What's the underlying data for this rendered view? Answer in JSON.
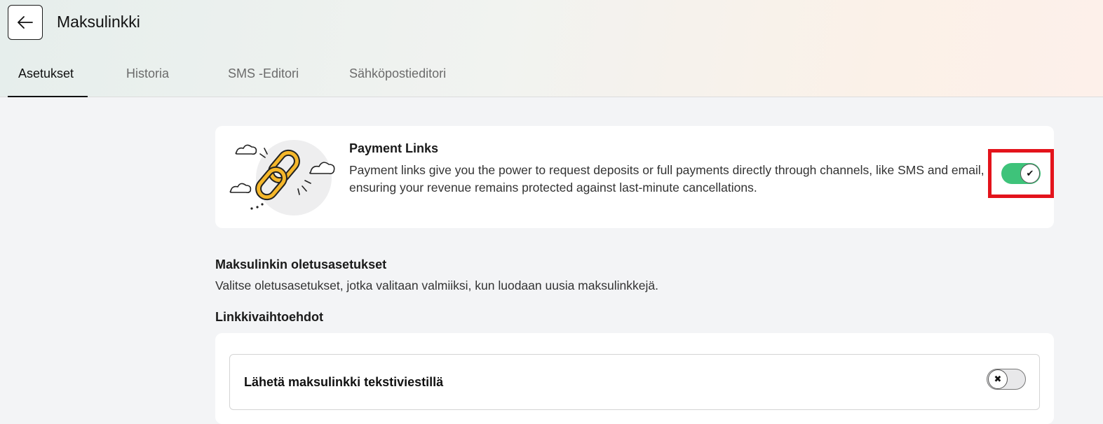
{
  "header": {
    "title": "Maksulinkki",
    "back_icon": "arrow-left-icon"
  },
  "tabs": [
    {
      "label": "Asetukset",
      "active": true
    },
    {
      "label": "Historia",
      "active": false
    },
    {
      "label": "SMS -Editori",
      "active": false
    },
    {
      "label": "Sähköpostieditori",
      "active": false
    }
  ],
  "payment_links": {
    "title": "Payment Links",
    "description": "Payment links give you the power to request deposits or full payments directly through channels, like SMS and email, ensuring your revenue remains protected against last-minute cancellations.",
    "enabled": true,
    "toggle_icon": "check-icon",
    "illustration": "chain-link-illustration"
  },
  "defaults": {
    "title": "Maksulinkin oletusasetukset",
    "description": "Valitse oletusasetukset, jotka valitaan valmiiksi, kun luodaan uusia maksulinkkejä."
  },
  "link_options": {
    "title": "Linkkivaihtoehdot",
    "items": [
      {
        "label": "Lähetä maksulinkki tekstiviestillä",
        "enabled": false,
        "toggle_icon": "x-icon"
      }
    ]
  },
  "colors": {
    "toggle_on": "#3ec37a",
    "highlight": "#e3131b",
    "background": "#f3f4f6"
  }
}
